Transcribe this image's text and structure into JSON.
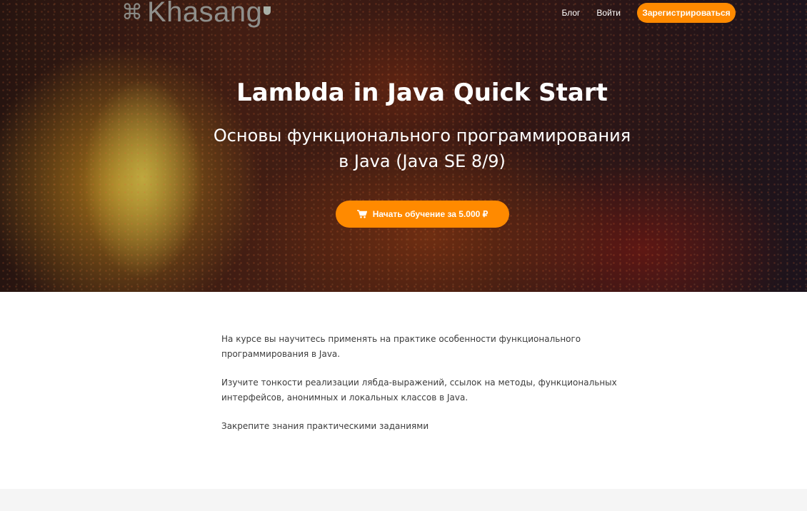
{
  "header": {
    "logo_text": "Khasang",
    "nav_links": [
      "Блог",
      "Войти"
    ],
    "register_label": "Зарегистрироваться"
  },
  "hero": {
    "title": "Lambda in Java Quick Start",
    "subtitle_line1": "Основы функционального программирования",
    "subtitle_line2": "в Java (Java SE 8/9)",
    "cta_label": "Начать обучение за 5.000 ₽",
    "cta_icon": "cart-icon"
  },
  "description": [
    "На курсе вы научитесь применять на практике особенности функционального программирования в Java.",
    "Изучите тонкости реализации лябда-выражений, ссылок на методы, функциональных интерфейсов, анонимных и локальных классов в Java.",
    "Закрепите знания практическими заданиями"
  ],
  "colors": {
    "accent": "#ff8a00",
    "text": "#3c3c3c",
    "footer_band": "#f5f5f5"
  }
}
